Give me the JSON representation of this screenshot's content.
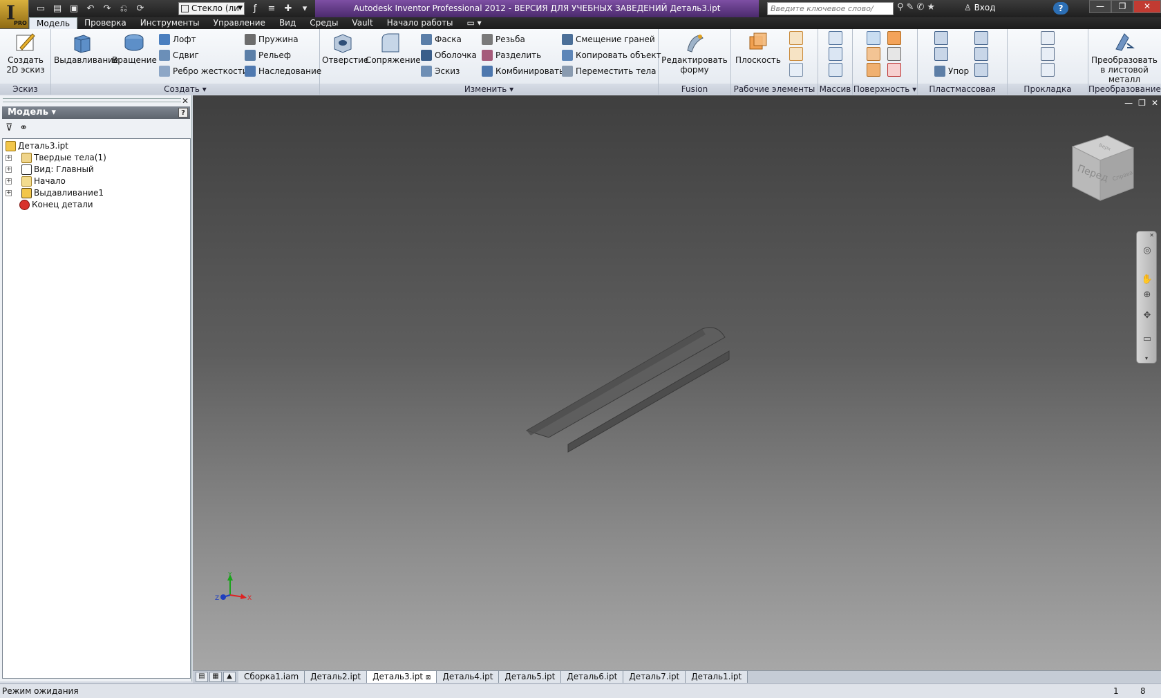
{
  "app": {
    "title": "Autodesk Inventor Professional 2012 - ВЕРСИЯ ДЛЯ УЧЕБНЫХ ЗАВЕДЕНИЙ    Деталь3.ipt",
    "logo_letter": "I",
    "logo_badge": "PRO"
  },
  "quick_access": {
    "material": "Стекло (ли",
    "search_placeholder": "Введите ключевое слово/фразу",
    "login": "Вход",
    "help": "?"
  },
  "ribbon_tabs": [
    "Модель",
    "Проверка",
    "Инструменты",
    "Управление",
    "Вид",
    "Среды",
    "Vault",
    "Начало работы"
  ],
  "ribbon": {
    "sketch": {
      "title": "Эскиз",
      "create_sketch": "Создать 2D эскиз"
    },
    "create": {
      "title": "Создать",
      "extrude": "Выдавливание",
      "revolve": "Вращение",
      "loft": "Лофт",
      "sweep": "Сдвиг",
      "rib": "Ребро жесткости",
      "coil": "Пружина",
      "emboss": "Рельеф",
      "derive": "Наследование"
    },
    "modify": {
      "title": "Изменить",
      "hole": "Отверстие",
      "fillet": "Сопряжение",
      "chamfer": "Фаска",
      "shell": "Оболочка",
      "draft": "Эскиз",
      "thread": "Резьба",
      "split": "Разделить",
      "combine": "Комбинировать",
      "direct_edit": "Смещение граней",
      "copy_object": "Копировать объект",
      "move_bodies": "Переместить тела"
    },
    "fusion": {
      "title": "Fusion",
      "edit_form": "Редактировать форму"
    },
    "work_features": {
      "title": "Рабочие элементы",
      "plane": "Плоскость"
    },
    "pattern": {
      "title": "Массив"
    },
    "surface": {
      "title": "Поверхность"
    },
    "plastic": {
      "title": "Пластмассовая деталь",
      "rest": "Упор"
    },
    "harness": {
      "title": "Прокладка кабелей"
    },
    "convert": {
      "title": "Преобразование",
      "to_sheet_metal": "Преобразовать в листовой металл"
    }
  },
  "browser": {
    "title": "Модель",
    "help": "?",
    "tree": [
      {
        "label": "Деталь3.ipt",
        "icon": "part-icon",
        "level": 0,
        "expander": false
      },
      {
        "label": "Твердые тела(1)",
        "icon": "solid-bodies-icon",
        "level": 1,
        "expander": true
      },
      {
        "label": "Вид: Главный",
        "icon": "view-icon",
        "level": 1,
        "expander": true
      },
      {
        "label": "Начало",
        "icon": "folder-icon",
        "level": 1,
        "expander": true
      },
      {
        "label": "Выдавливание1",
        "icon": "extrude-icon",
        "level": 1,
        "expander": true
      },
      {
        "label": "Конец детали",
        "icon": "end-of-part-icon",
        "level": 1,
        "expander": false
      }
    ]
  },
  "viewcube": {
    "front": "Перед",
    "right": "Справа",
    "top": "Верх"
  },
  "triad": {
    "x": "X",
    "y": "Y",
    "z": "Z"
  },
  "doc_tabs": [
    "Сборка1.iam",
    "Деталь2.ipt",
    "Деталь3.ipt",
    "Деталь4.ipt",
    "Деталь5.ipt",
    "Деталь6.ipt",
    "Деталь7.ipt",
    "Деталь1.ipt"
  ],
  "active_doc_tab": "Деталь3.ipt",
  "status": {
    "text": "Режим ожидания",
    "n1": "1",
    "n2": "8"
  },
  "colors": {
    "title_accent": "#6a3f91",
    "viewport_top": "#3f3f3f",
    "viewport_bottom": "#a7a7a7"
  }
}
